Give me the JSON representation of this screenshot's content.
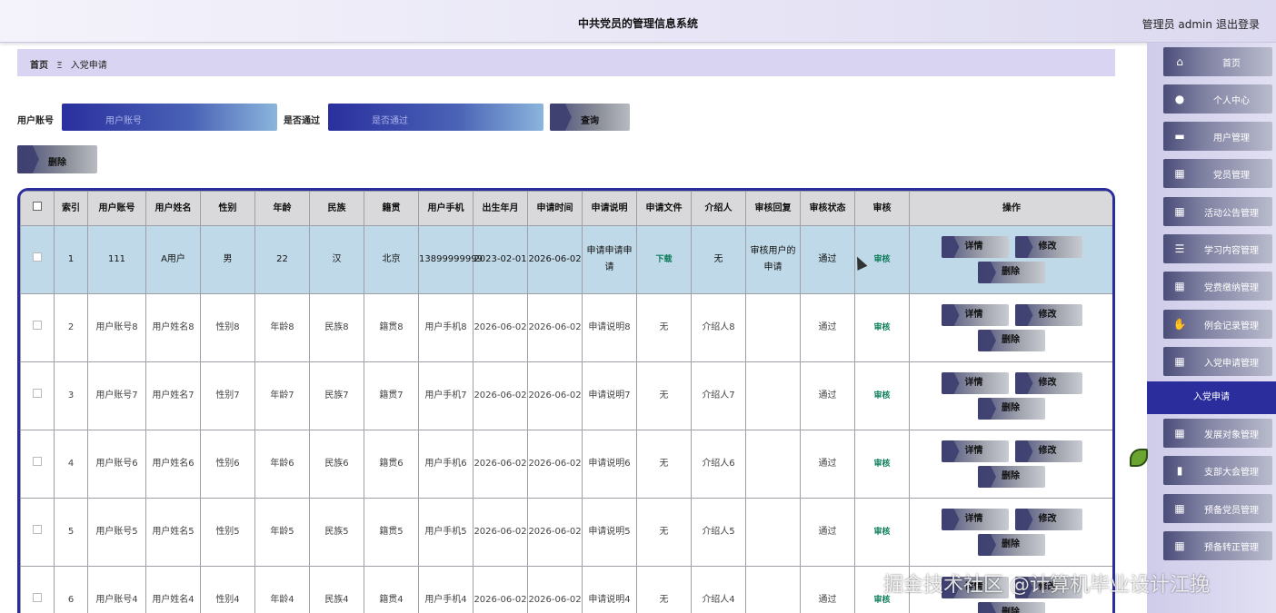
{
  "header": {
    "title": "中共党员的管理信息系统",
    "user": "管理员 admin",
    "logout": "退出登录"
  },
  "breadcrumb": {
    "home": "首页",
    "sep": "Ξ",
    "current": "入党申请"
  },
  "search": {
    "account_label": "用户账号",
    "account_placeholder": "用户账号",
    "passed_label": "是否通过",
    "passed_placeholder": "是否通过",
    "query_button": "查询"
  },
  "toolbar": {
    "delete_button": "删除"
  },
  "table": {
    "headers": [
      "",
      "索引",
      "用户账号",
      "用户姓名",
      "性别",
      "年龄",
      "民族",
      "籍贯",
      "用户手机",
      "出生年月",
      "申请时间",
      "申请说明",
      "申请文件",
      "介绍人",
      "审核回复",
      "审核状态",
      "审核",
      "操作"
    ],
    "rows": [
      {
        "index": "1",
        "account": "111",
        "name": "A用户",
        "gender": "男",
        "age": "22",
        "ethnic": "汉",
        "native": "北京",
        "phone": "13899999999",
        "birth": "2023-02-01",
        "apply_time": "2026-06-02",
        "desc": "申请申请申请",
        "file": "下载",
        "introducer": "无",
        "reply": "审核用户的申请",
        "status": "通过",
        "audit": "审核"
      },
      {
        "index": "2",
        "account": "用户账号8",
        "name": "用户姓名8",
        "gender": "性别8",
        "age": "年龄8",
        "ethnic": "民族8",
        "native": "籍贯8",
        "phone": "用户手机8",
        "birth": "2026-06-02",
        "apply_time": "2026-06-02",
        "desc": "申请说明8",
        "file": "无",
        "introducer": "介绍人8",
        "reply": "",
        "status": "通过",
        "audit": "审核"
      },
      {
        "index": "3",
        "account": "用户账号7",
        "name": "用户姓名7",
        "gender": "性别7",
        "age": "年龄7",
        "ethnic": "民族7",
        "native": "籍贯7",
        "phone": "用户手机7",
        "birth": "2026-06-02",
        "apply_time": "2026-06-02",
        "desc": "申请说明7",
        "file": "无",
        "introducer": "介绍人7",
        "reply": "",
        "status": "通过",
        "audit": "审核"
      },
      {
        "index": "4",
        "account": "用户账号6",
        "name": "用户姓名6",
        "gender": "性别6",
        "age": "年龄6",
        "ethnic": "民族6",
        "native": "籍贯6",
        "phone": "用户手机6",
        "birth": "2026-06-02",
        "apply_time": "2026-06-02",
        "desc": "申请说明6",
        "file": "无",
        "introducer": "介绍人6",
        "reply": "",
        "status": "通过",
        "audit": "审核"
      },
      {
        "index": "5",
        "account": "用户账号5",
        "name": "用户姓名5",
        "gender": "性别5",
        "age": "年龄5",
        "ethnic": "民族5",
        "native": "籍贯5",
        "phone": "用户手机5",
        "birth": "2026-06-02",
        "apply_time": "2026-06-02",
        "desc": "申请说明5",
        "file": "无",
        "introducer": "介绍人5",
        "reply": "",
        "status": "通过",
        "audit": "审核"
      },
      {
        "index": "6",
        "account": "用户账号4",
        "name": "用户姓名4",
        "gender": "性别4",
        "age": "年龄4",
        "ethnic": "民族4",
        "native": "籍贯4",
        "phone": "用户手机4",
        "birth": "2026-06-02",
        "apply_time": "2026-06-02",
        "desc": "申请说明4",
        "file": "无",
        "introducer": "介绍人4",
        "reply": "",
        "status": "通过",
        "audit": "审核"
      }
    ],
    "actions": {
      "detail": "详情",
      "edit": "修改",
      "delete": "删除"
    }
  },
  "sidebar": {
    "items": [
      {
        "label": "首页",
        "icon": "home-icon"
      },
      {
        "label": "个人中心",
        "icon": "person-icon"
      },
      {
        "label": "用户管理",
        "icon": "chat-icon"
      },
      {
        "label": "党员管理",
        "icon": "grid-icon"
      },
      {
        "label": "活动公告管理",
        "icon": "grid-icon"
      },
      {
        "label": "学习内容管理",
        "icon": "list-icon"
      },
      {
        "label": "党费缴纳管理",
        "icon": "grid-icon"
      },
      {
        "label": "例会记录管理",
        "icon": "thumb-icon"
      },
      {
        "label": "入党申请管理",
        "icon": "grid-icon"
      },
      {
        "label": "发展对象管理",
        "icon": "grid-icon"
      },
      {
        "label": "支部大会管理",
        "icon": "book-icon"
      },
      {
        "label": "预备党员管理",
        "icon": "grid-icon"
      },
      {
        "label": "预备转正管理",
        "icon": "grid-icon"
      }
    ],
    "active_sub": "入党申请"
  },
  "watermark": "掘金技术社区 @计算机毕业设计江挽",
  "colors": {
    "accent": "#2c2d9c",
    "selected_row": "#bfd9e8",
    "audit_green": "#0b7d5a"
  }
}
